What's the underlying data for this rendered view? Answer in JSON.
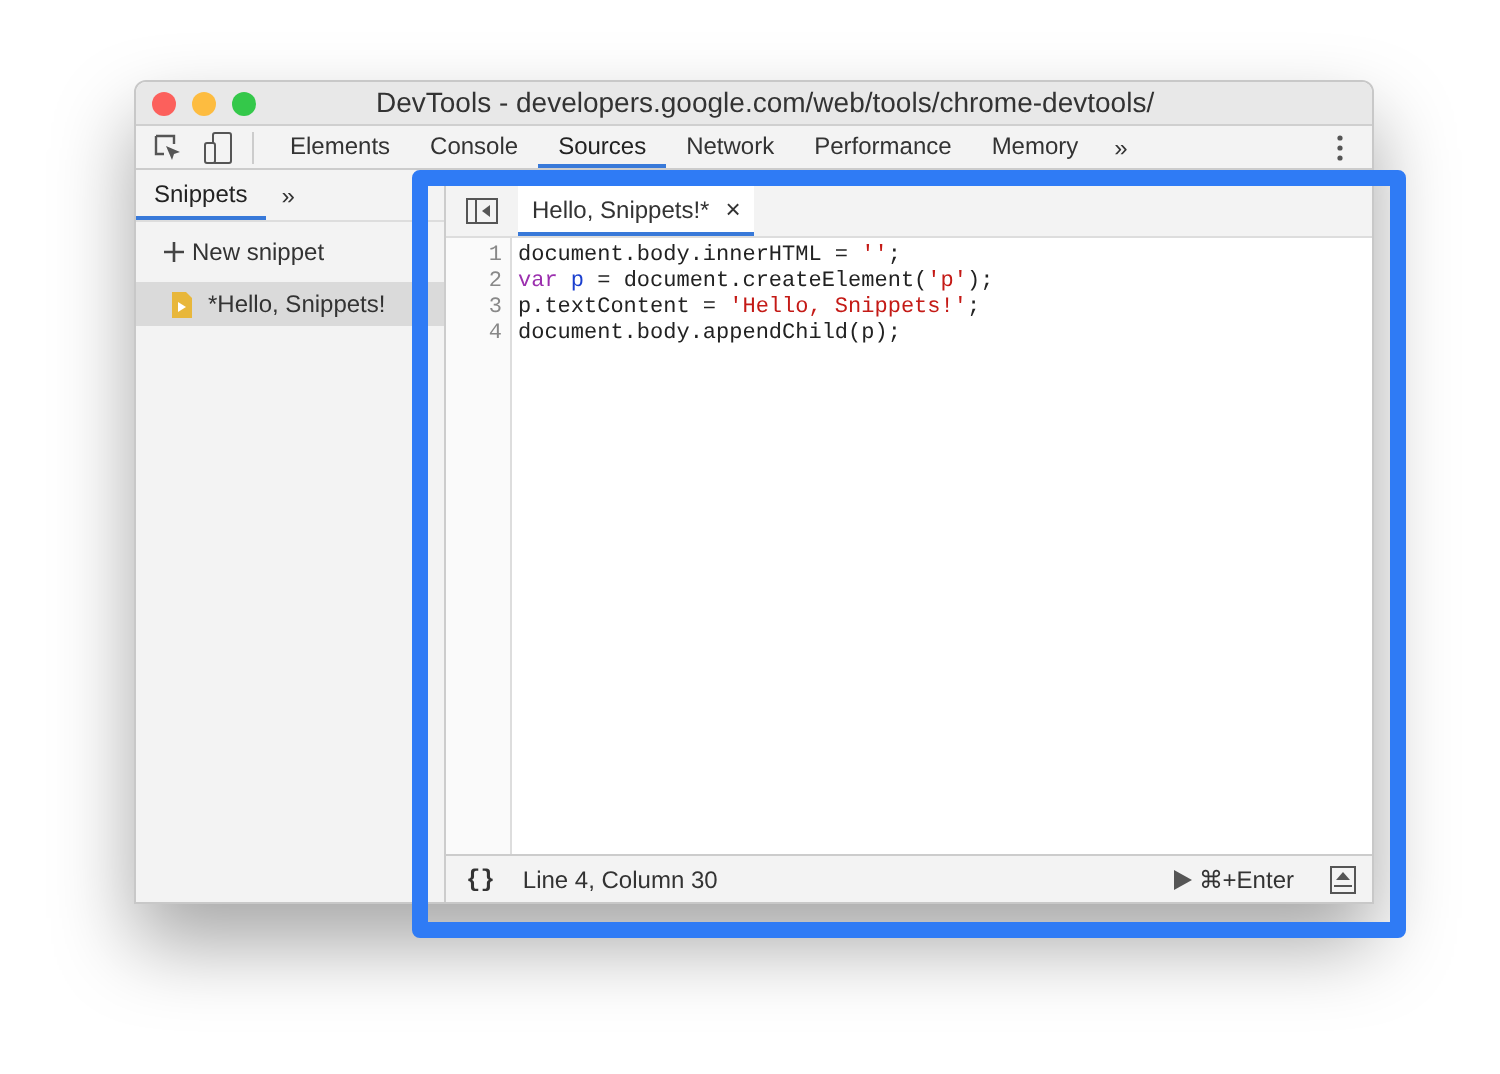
{
  "window": {
    "title": "DevTools - developers.google.com/web/tools/chrome-devtools/"
  },
  "panel_tabs": [
    {
      "label": "Elements",
      "selected": false
    },
    {
      "label": "Console",
      "selected": false
    },
    {
      "label": "Sources",
      "selected": true
    },
    {
      "label": "Network",
      "selected": false
    },
    {
      "label": "Performance",
      "selected": false
    },
    {
      "label": "Memory",
      "selected": false
    }
  ],
  "panel_overflow": "»",
  "sidebar": {
    "tabs": [
      {
        "label": "Snippets",
        "selected": true
      }
    ],
    "overflow": "»",
    "new_label": "New snippet",
    "items": [
      {
        "label": "*Hello, Snippets!",
        "selected": true
      }
    ]
  },
  "editor": {
    "tabs": [
      {
        "label": "Hello, Snippets!*",
        "selected": true,
        "close": "×"
      }
    ],
    "lines": [
      {
        "number": "1",
        "tokens": [
          {
            "kind": "plain",
            "text": "document.body.innerHTML = "
          },
          {
            "kind": "string",
            "text": "''"
          },
          {
            "kind": "plain",
            "text": ";"
          }
        ]
      },
      {
        "number": "2",
        "tokens": [
          {
            "kind": "keyword",
            "text": "var "
          },
          {
            "kind": "def",
            "text": "p"
          },
          {
            "kind": "plain",
            "text": " = document.createElement("
          },
          {
            "kind": "string",
            "text": "'p'"
          },
          {
            "kind": "plain",
            "text": ");"
          }
        ]
      },
      {
        "number": "3",
        "tokens": [
          {
            "kind": "plain",
            "text": "p.textContent = "
          },
          {
            "kind": "string",
            "text": "'Hello, Snippets!'"
          },
          {
            "kind": "plain",
            "text": ";"
          }
        ]
      },
      {
        "number": "4",
        "tokens": [
          {
            "kind": "plain",
            "text": "document.body.appendChild(p);"
          }
        ]
      }
    ]
  },
  "status_bar": {
    "format_label": "{}",
    "position": "Line 4, Column 30",
    "run_label": "⌘+Enter"
  }
}
